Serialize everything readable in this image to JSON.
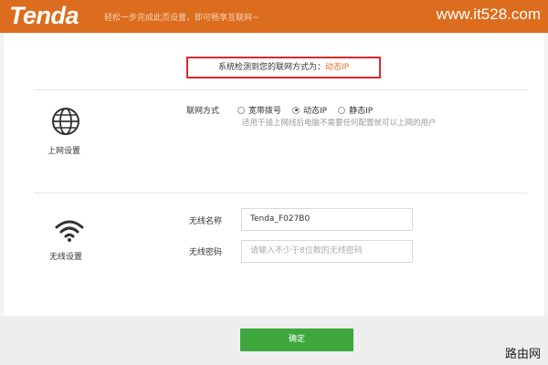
{
  "header": {
    "logo_text": "Tenda",
    "tagline": "轻松一步完成此页设置，即可畅享互联网~",
    "site_watermark": "www.it528.com"
  },
  "detection": {
    "prefix": "系统检测到您的联网方式为：",
    "value": "动态IP"
  },
  "internet_section": {
    "label": "上网设置",
    "icon": "globe-icon",
    "field_label": "联网方式",
    "options": [
      {
        "label": "宽带拨号",
        "checked": false
      },
      {
        "label": "动态IP",
        "checked": true
      },
      {
        "label": "静态IP",
        "checked": false
      }
    ],
    "hint": "适用于插上网线后电脑不需要任何配置就可以上网的用户"
  },
  "wireless_section": {
    "label": "无线设置",
    "icon": "wifi-icon",
    "ssid_label": "无线名称",
    "ssid_value": "Tenda_F027B0",
    "password_label": "无线密码",
    "password_placeholder": "请输入不少于8位数的无线密码"
  },
  "footer": {
    "confirm_label": "确定",
    "corner_watermark": "路由网"
  },
  "colors": {
    "header": "#dc6d1e",
    "highlight_border": "#d72a2a",
    "highlight_value": "#e0701e",
    "confirm_button": "#3ea83c"
  }
}
